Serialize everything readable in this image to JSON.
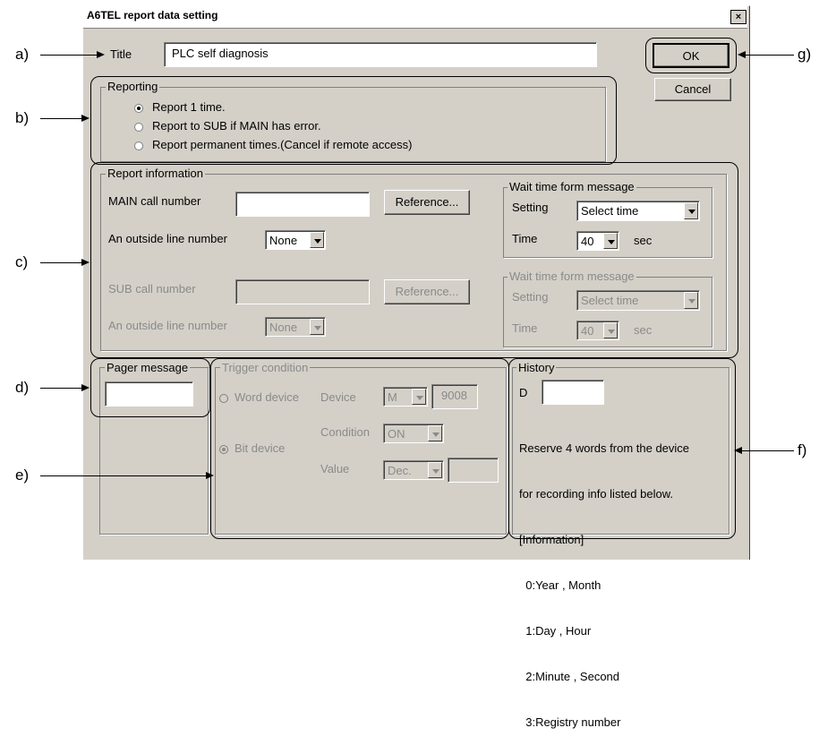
{
  "window": {
    "title": "A6TEL report data setting",
    "close_label": "×"
  },
  "title_field": {
    "label": "Title",
    "value": "PLC self diagnosis"
  },
  "buttons": {
    "ok": "OK",
    "cancel": "Cancel"
  },
  "reporting": {
    "legend": "Reporting",
    "options": [
      "Report 1 time.",
      "Report to SUB if MAIN has error.",
      "Report permanent times.(Cancel if remote access)"
    ],
    "selected_index": 0
  },
  "report_info": {
    "legend": "Report information",
    "main_call_label": "MAIN call number",
    "main_call_value": "",
    "outside_line_label": "An outside line number",
    "outside_line_value": "None",
    "reference_label": "Reference...",
    "sub_call_label": "SUB call number",
    "sub_call_value": "",
    "sub_outside_line_label": "An outside line number",
    "sub_outside_line_value": "None",
    "sub_reference_label": "Reference...",
    "wait_main": {
      "legend": "Wait time form message",
      "setting_label": "Setting",
      "setting_value": "Select time",
      "time_label": "Time",
      "time_value": "40",
      "unit": "sec"
    },
    "wait_sub": {
      "legend": "Wait time form message",
      "setting_label": "Setting",
      "setting_value": "Select time",
      "time_label": "Time",
      "time_value": "40",
      "unit": "sec"
    }
  },
  "pager": {
    "legend": "Pager message",
    "value": ""
  },
  "trigger": {
    "legend": "Trigger condition",
    "word_device_label": "Word device",
    "bit_device_label": "Bit device",
    "selected": "bit",
    "device_label": "Device",
    "device_value": "M",
    "device_number": "9008",
    "condition_label": "Condition",
    "condition_value": "ON",
    "value_label": "Value",
    "value_format": "Dec.",
    "value_value": ""
  },
  "history": {
    "legend": "History",
    "device_prefix": "D",
    "device_value": "",
    "description": [
      "Reserve 4 words from the device",
      "for recording info listed below.",
      "[Information]",
      "  0:Year , Month",
      "  1:Day , Hour",
      "  2:Minute , Second",
      "  3:Registry number"
    ]
  },
  "annotations": {
    "a": "a)",
    "b": "b)",
    "c": "c)",
    "d": "d)",
    "e": "e)",
    "f": "f)",
    "g": "g)"
  }
}
